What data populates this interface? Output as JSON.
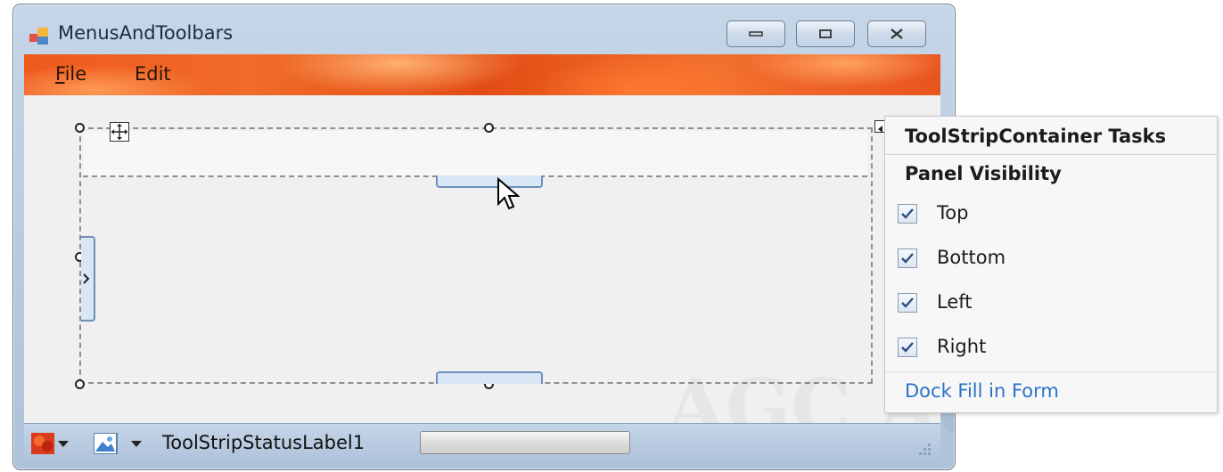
{
  "window": {
    "title": "MenusAndToolbars",
    "buttons": {
      "minimize": "minimize-icon",
      "restore": "restore-icon",
      "close": "close-icon"
    }
  },
  "menu": {
    "items": [
      {
        "label": "File",
        "mnemonic": "F"
      },
      {
        "label": "Edit"
      }
    ]
  },
  "statusbar": {
    "label": "ToolStripStatusLabel1",
    "icons": [
      "flower-image-icon",
      "picture-icon"
    ]
  },
  "tasks": {
    "title": "ToolStripContainer Tasks",
    "section": "Panel Visibility",
    "checks": [
      {
        "label": "Top",
        "checked": true
      },
      {
        "label": "Bottom",
        "checked": true
      },
      {
        "label": "Left",
        "checked": true
      },
      {
        "label": "Right",
        "checked": true
      }
    ],
    "link": "Dock Fill in Form"
  },
  "colors": {
    "accent_link": "#2b73c8",
    "menubar_orange": "#ee5a1e",
    "status_blue": "#aec2da"
  }
}
